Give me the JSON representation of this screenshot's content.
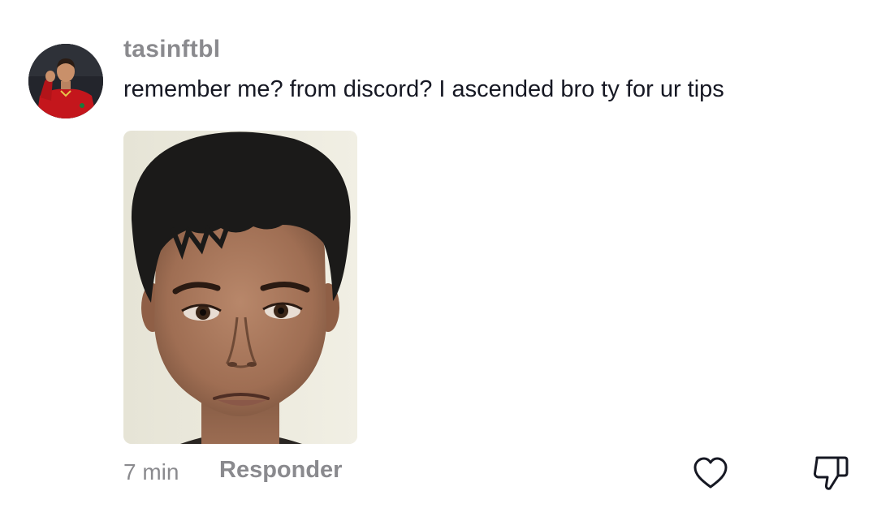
{
  "comment": {
    "username": "tasinftbl",
    "text": "remember me? from discord? I ascended bro ty for ur tips",
    "timestamp": "7 min",
    "reply_label": "Responder"
  },
  "icons": {
    "like": "heart-outline-icon",
    "dislike": "thumbs-down-outline-icon"
  },
  "colors": {
    "primary_text": "#161823",
    "secondary_text": "#8a8a8e",
    "icon": "#161823",
    "background": "#ffffff"
  }
}
